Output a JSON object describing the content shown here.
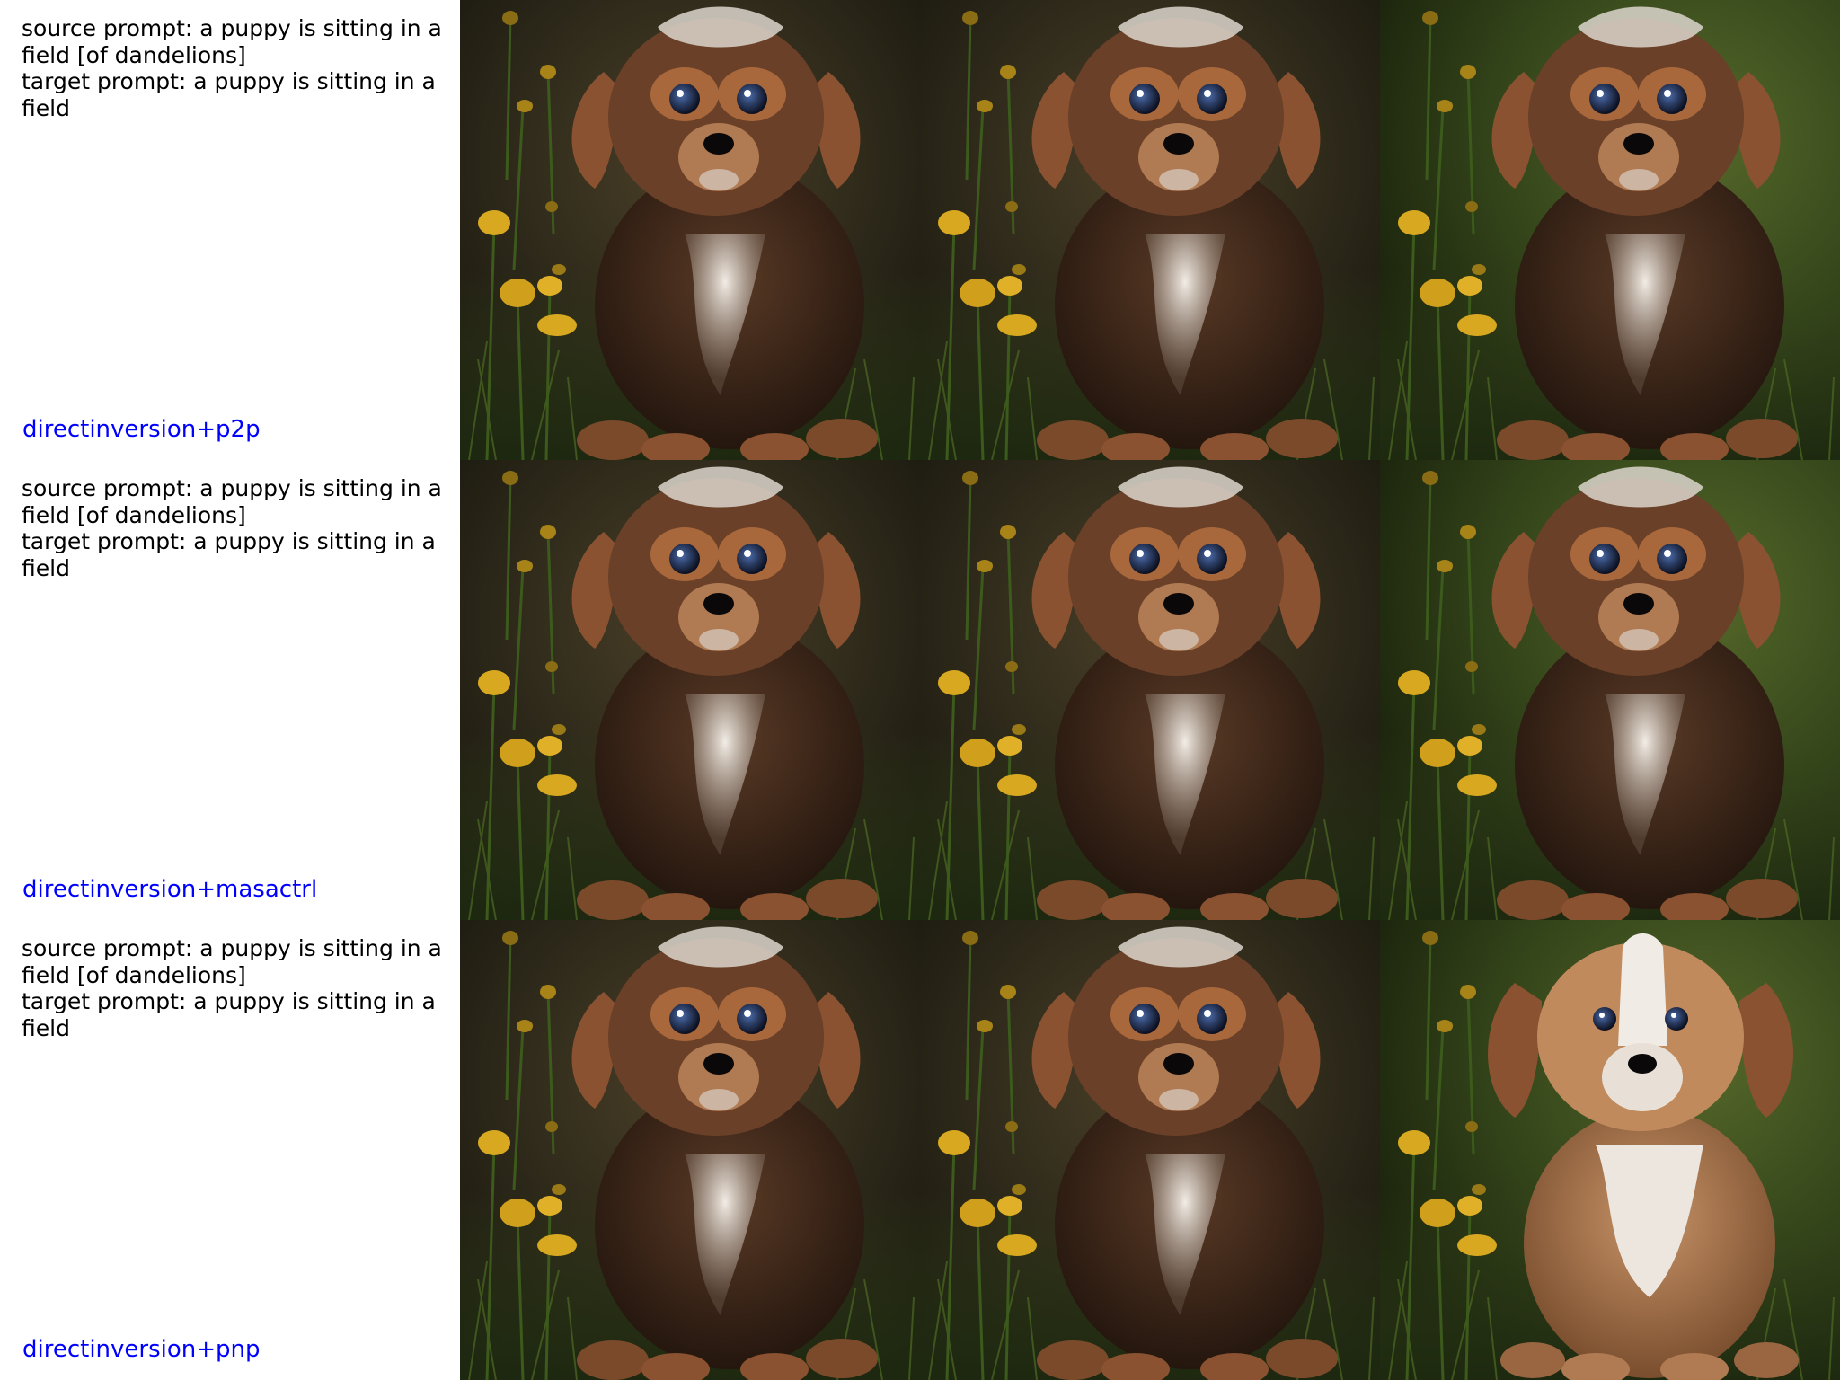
{
  "rows": [
    {
      "source_prompt": "source prompt: a puppy is sitting in a field [of dandelions]",
      "target_prompt": "target prompt: a puppy is sitting in a field",
      "method": "directinversion+p2p"
    },
    {
      "source_prompt": "source prompt: a puppy is sitting in a field [of dandelions]",
      "target_prompt": "target prompt: a puppy is sitting in a field",
      "method": "directinversion+masactrl"
    },
    {
      "source_prompt": "source prompt: a puppy is sitting in a field [of dandelions]",
      "target_prompt": "target prompt: a puppy is sitting in a field",
      "method": "directinversion+pnp"
    }
  ],
  "colors": {
    "method_label": "#0000ff",
    "prompt_text": "#000000",
    "bg_dark": "#2a2618",
    "bg_green": "#3b4a1c",
    "fur_dark": "#3a2418",
    "fur_brown": "#8a5230",
    "fur_white": "#e6e0d8",
    "fur_light_brown": "#b07a52",
    "dandelion": "#d8a820"
  }
}
